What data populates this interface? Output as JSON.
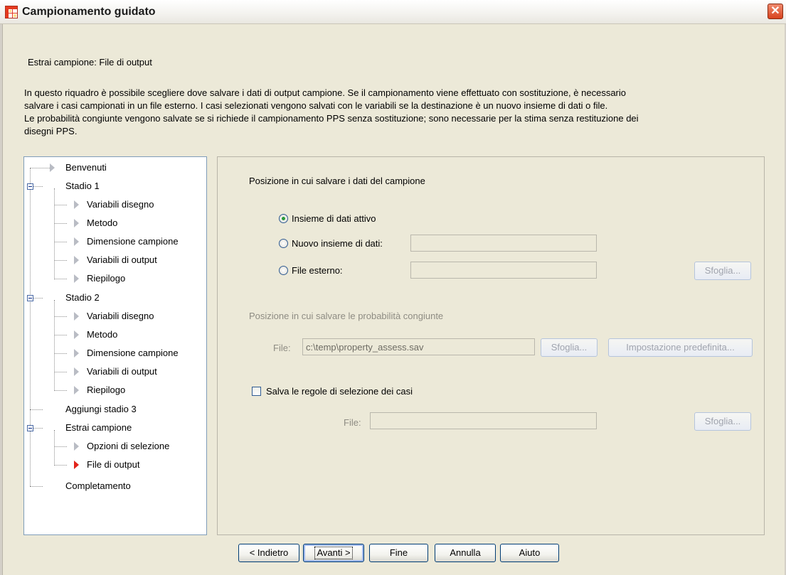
{
  "window": {
    "title": "Campionamento guidato",
    "close_label": "✕"
  },
  "header": {
    "subtitle": "Estrai campione: File di output",
    "description_lines": [
      "In questo riquadro è possibile scegliere dove salvare i dati di output campione. Se il campionamento viene effettuato con sostituzione, è necessario",
      "salvare i casi campionati in un file esterno. I casi selezionati vengono salvati con le variabili se la destinazione è un nuovo insieme di dati o file.",
      "Le probabilità congiunte vengono salvate se si richiede il campionamento PPS senza sostituzione; sono necessarie per la stima senza restituzione dei",
      "disegni PPS."
    ]
  },
  "nav": {
    "items": [
      "Benvenuti",
      "Stadio 1",
      "Variabili disegno",
      "Metodo",
      "Dimensione campione",
      "Variabili di output",
      "Riepilogo",
      "Stadio 2",
      "Variabili disegno",
      "Metodo",
      "Dimensione campione",
      "Variabili di output",
      "Riepilogo",
      "Aggiungi stadio 3",
      "Estrai campione",
      "Opzioni di selezione",
      "File di output",
      "Completamento"
    ],
    "active_item": "File di output"
  },
  "main": {
    "save_location_heading": "Posizione in cui salvare i dati del campione",
    "options": {
      "active_dataset": "Insieme di dati attivo",
      "new_dataset": "Nuovo insieme di dati:",
      "external_file": "File esterno:"
    },
    "selected_option": "active_dataset",
    "new_dataset_value": "",
    "external_file_value": "",
    "browse_label": "Sfoglia...",
    "joint_prob_heading": "Posizione in cui salvare le probabilità congiunte",
    "joint_prob_file_label": "File:",
    "joint_prob_file_value": "c:\\temp\\property_assess.sav",
    "default_button_label": "Impostazione predefinita...",
    "save_rules_label": "Salva le regole di selezione dei casi",
    "save_rules_checked": false,
    "rules_file_label": "File:",
    "rules_file_value": ""
  },
  "footer": {
    "back": "< Indietro",
    "next": "Avanti >",
    "finish": "Fine",
    "cancel": "Annulla",
    "help": "Aiuto"
  }
}
